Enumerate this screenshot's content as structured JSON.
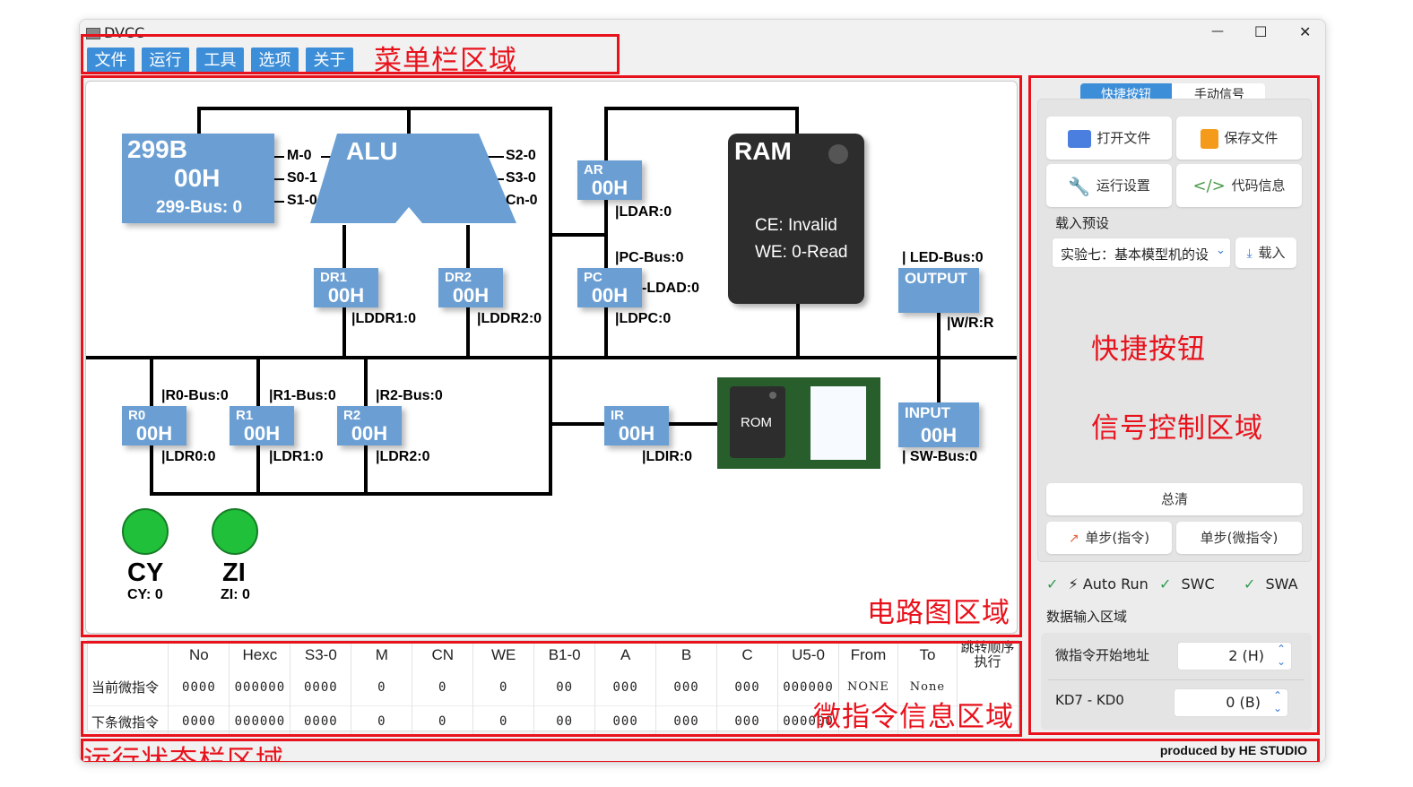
{
  "window": {
    "title": "DVCC",
    "controls": [
      "—",
      "☐",
      "✕"
    ]
  },
  "menu": [
    {
      "label": "文件"
    },
    {
      "label": "运行"
    },
    {
      "label": "工具"
    },
    {
      "label": "选项"
    },
    {
      "label": "关于"
    }
  ],
  "annotations": {
    "menubar": "菜单栏区域",
    "circuit": "电路图区域",
    "quick": "快捷按钮",
    "signal": "信号控制区域",
    "micro": "微指令信息区域",
    "status": "运行状态栏区域"
  },
  "circuit": {
    "b299": {
      "name": "299B",
      "value": "00H",
      "bus": "299-Bus: 0",
      "signals": [
        "M-0",
        "S0-1",
        "S1-0"
      ]
    },
    "alu": {
      "name": "ALU",
      "signals": [
        "S2-0",
        "S3-0",
        "Cn-0"
      ]
    },
    "dr1": {
      "name": "DR1",
      "value": "00H",
      "ld": "|LDDR1:0"
    },
    "dr2": {
      "name": "DR2",
      "value": "00H",
      "ld": "|LDDR2:0"
    },
    "ar": {
      "name": "AR",
      "value": "00H",
      "ld": "|LDAR:0"
    },
    "pc": {
      "name": "PC",
      "value": "00H",
      "bus": "|PC-Bus:0",
      "lad": "-LDAD:0",
      "ld": "|LDPC:0"
    },
    "ram": {
      "name": "RAM",
      "ce": "CE: Invalid",
      "we": "WE: 0-Read"
    },
    "output": {
      "name": "OUTPUT",
      "bus": "| LED-Bus:0",
      "wr": "|W/R:R"
    },
    "r0": {
      "name": "R0",
      "value": "00H",
      "bus": "|R0-Bus:0",
      "ld": "|LDR0:0"
    },
    "r1": {
      "name": "R1",
      "value": "00H",
      "bus": "|R1-Bus:0",
      "ld": "|LDR1:0"
    },
    "r2": {
      "name": "R2",
      "value": "00H",
      "bus": "|R2-Bus:0",
      "ld": "|LDR2:0"
    },
    "ir": {
      "name": "IR",
      "value": "00H",
      "ld": "|LDIR:0"
    },
    "rom": {
      "name": "ROM"
    },
    "input": {
      "name": "INPUT",
      "value": "00H",
      "bus": "| SW-Bus:0"
    },
    "cy": {
      "name": "CY",
      "value": "CY: 0",
      "color": "#20c03a"
    },
    "zi": {
      "name": "ZI",
      "value": "ZI: 0",
      "color": "#20c03a"
    }
  },
  "panel": {
    "tabs": [
      {
        "label": "快捷按钮",
        "active": true
      },
      {
        "label": "手动信号",
        "active": false
      }
    ],
    "buttons": {
      "open": "打开文件",
      "save": "保存文件",
      "settings": "运行设置",
      "code": "代码信息"
    },
    "preset_label": "载入预设",
    "preset_value": "实验七：基本模型机的设",
    "load_label": "载入",
    "clear_label": "总清",
    "step_instr": "单步(指令)",
    "step_micro": "单步(微指令)",
    "checks": {
      "auto_run": "Auto Run",
      "swc": "SWC",
      "swa": "SWA"
    },
    "data_input_title": "数据输入区域",
    "start_addr_label": "微指令开始地址",
    "start_addr_value": "2 (H)",
    "kd_label": "KD7 - KD0",
    "kd_value": "0 (B)"
  },
  "micro_table": {
    "headers": [
      "No",
      "Hexc",
      "S3-0",
      "M",
      "CN",
      "WE",
      "B1-0",
      "A",
      "B",
      "C",
      "U5-0",
      "From",
      "To",
      "跳转顺序执行"
    ],
    "rows": [
      {
        "label": "当前微指令",
        "cells": [
          "0000",
          "000000",
          "0000",
          "0",
          "0",
          "0",
          "00",
          "000",
          "000",
          "000",
          "000000",
          "NONE",
          "None",
          ""
        ]
      },
      {
        "label": "下条微指令",
        "cells": [
          "0000",
          "000000",
          "0000",
          "0",
          "0",
          "0",
          "00",
          "000",
          "000",
          "000",
          "000000",
          "",
          "",
          ""
        ]
      }
    ]
  },
  "statusbar": {
    "credit": "produced by HE STUDIO"
  }
}
